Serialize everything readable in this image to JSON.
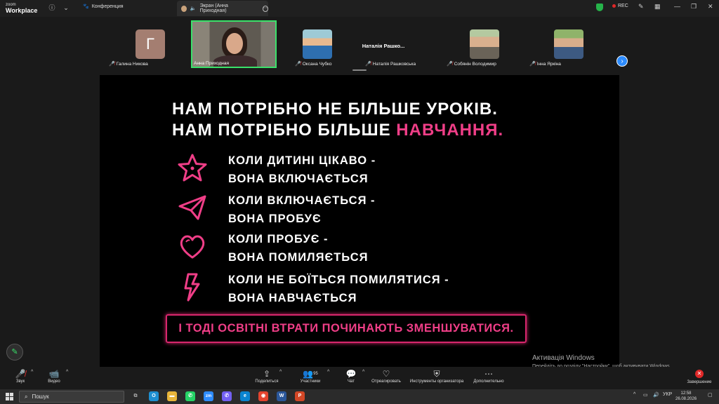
{
  "app": {
    "brand_top": "zoom",
    "brand_bottom": "Workplace"
  },
  "topbar": {
    "conference_label": "Конференция",
    "share_tab_label": "Экран (Анна Приходная)",
    "rec_label": "REC"
  },
  "participants": [
    {
      "name": "Галина Никова",
      "avatar_letter": "Г",
      "muted": true
    },
    {
      "name": "Анна Приходная",
      "muted": false,
      "active": true
    },
    {
      "name": "Оксана Чубко",
      "muted": true
    },
    {
      "name": "Наталія Рашковська",
      "card_label": "Наталія Рашко...",
      "muted": true
    },
    {
      "name": "Собянін Володимир",
      "muted": true
    },
    {
      "name": "Інна Яркіна",
      "muted": true
    }
  ],
  "slide": {
    "title_line1": "НАМ ПОТРІБНО НЕ БІЛЬШЕ УРОКІВ.",
    "title_line2_prefix": "НАМ ПОТРІБНО БІЛЬШЕ ",
    "title_line2_accent": "НАВЧАННЯ.",
    "items": [
      {
        "icon": "star-icon",
        "line1": "КОЛИ ДИТИНІ ЦІКАВО -",
        "line2": "ВОНА ВКЛЮЧАЄТЬСЯ"
      },
      {
        "icon": "paper-plane-icon",
        "line1": "КОЛИ ВКЛЮЧАЄТЬСЯ -",
        "line2": "ВОНА ПРОБУЄ"
      },
      {
        "icon": "heart-icon",
        "line1": "КОЛИ ПРОБУЄ -",
        "line2": "ВОНА ПОМИЛЯЄТЬСЯ"
      },
      {
        "icon": "lightning-icon",
        "line1": "КОЛИ НЕ БОЇТЬСЯ ПОМИЛЯТИСЯ -",
        "line2": "ВОНА НАВЧАЄТЬСЯ"
      }
    ],
    "banner": "І ТОДІ ОСВІТНІ ВТРАТИ ПОЧИНАЮТЬ ЗМЕНШУВАТИСЯ.",
    "accent_color": "#ef3e87"
  },
  "activation": {
    "line1": "Активація Windows",
    "line2": "Перейдіть до розділу \"Настройки\", щоб активувати Windows."
  },
  "toolbar": {
    "audio": "Звук",
    "video": "Видео",
    "share": "Поделиться",
    "participants": "Участники",
    "participants_count": "95",
    "chat": "Чат",
    "react": "Отреагировать",
    "host_tools": "Инструменты организатора",
    "more": "Дополнительно",
    "end": "Завершение"
  },
  "taskbar": {
    "search_placeholder": "Пошук",
    "language": "УКР",
    "time": "12:58",
    "date": "26.08.2026"
  }
}
